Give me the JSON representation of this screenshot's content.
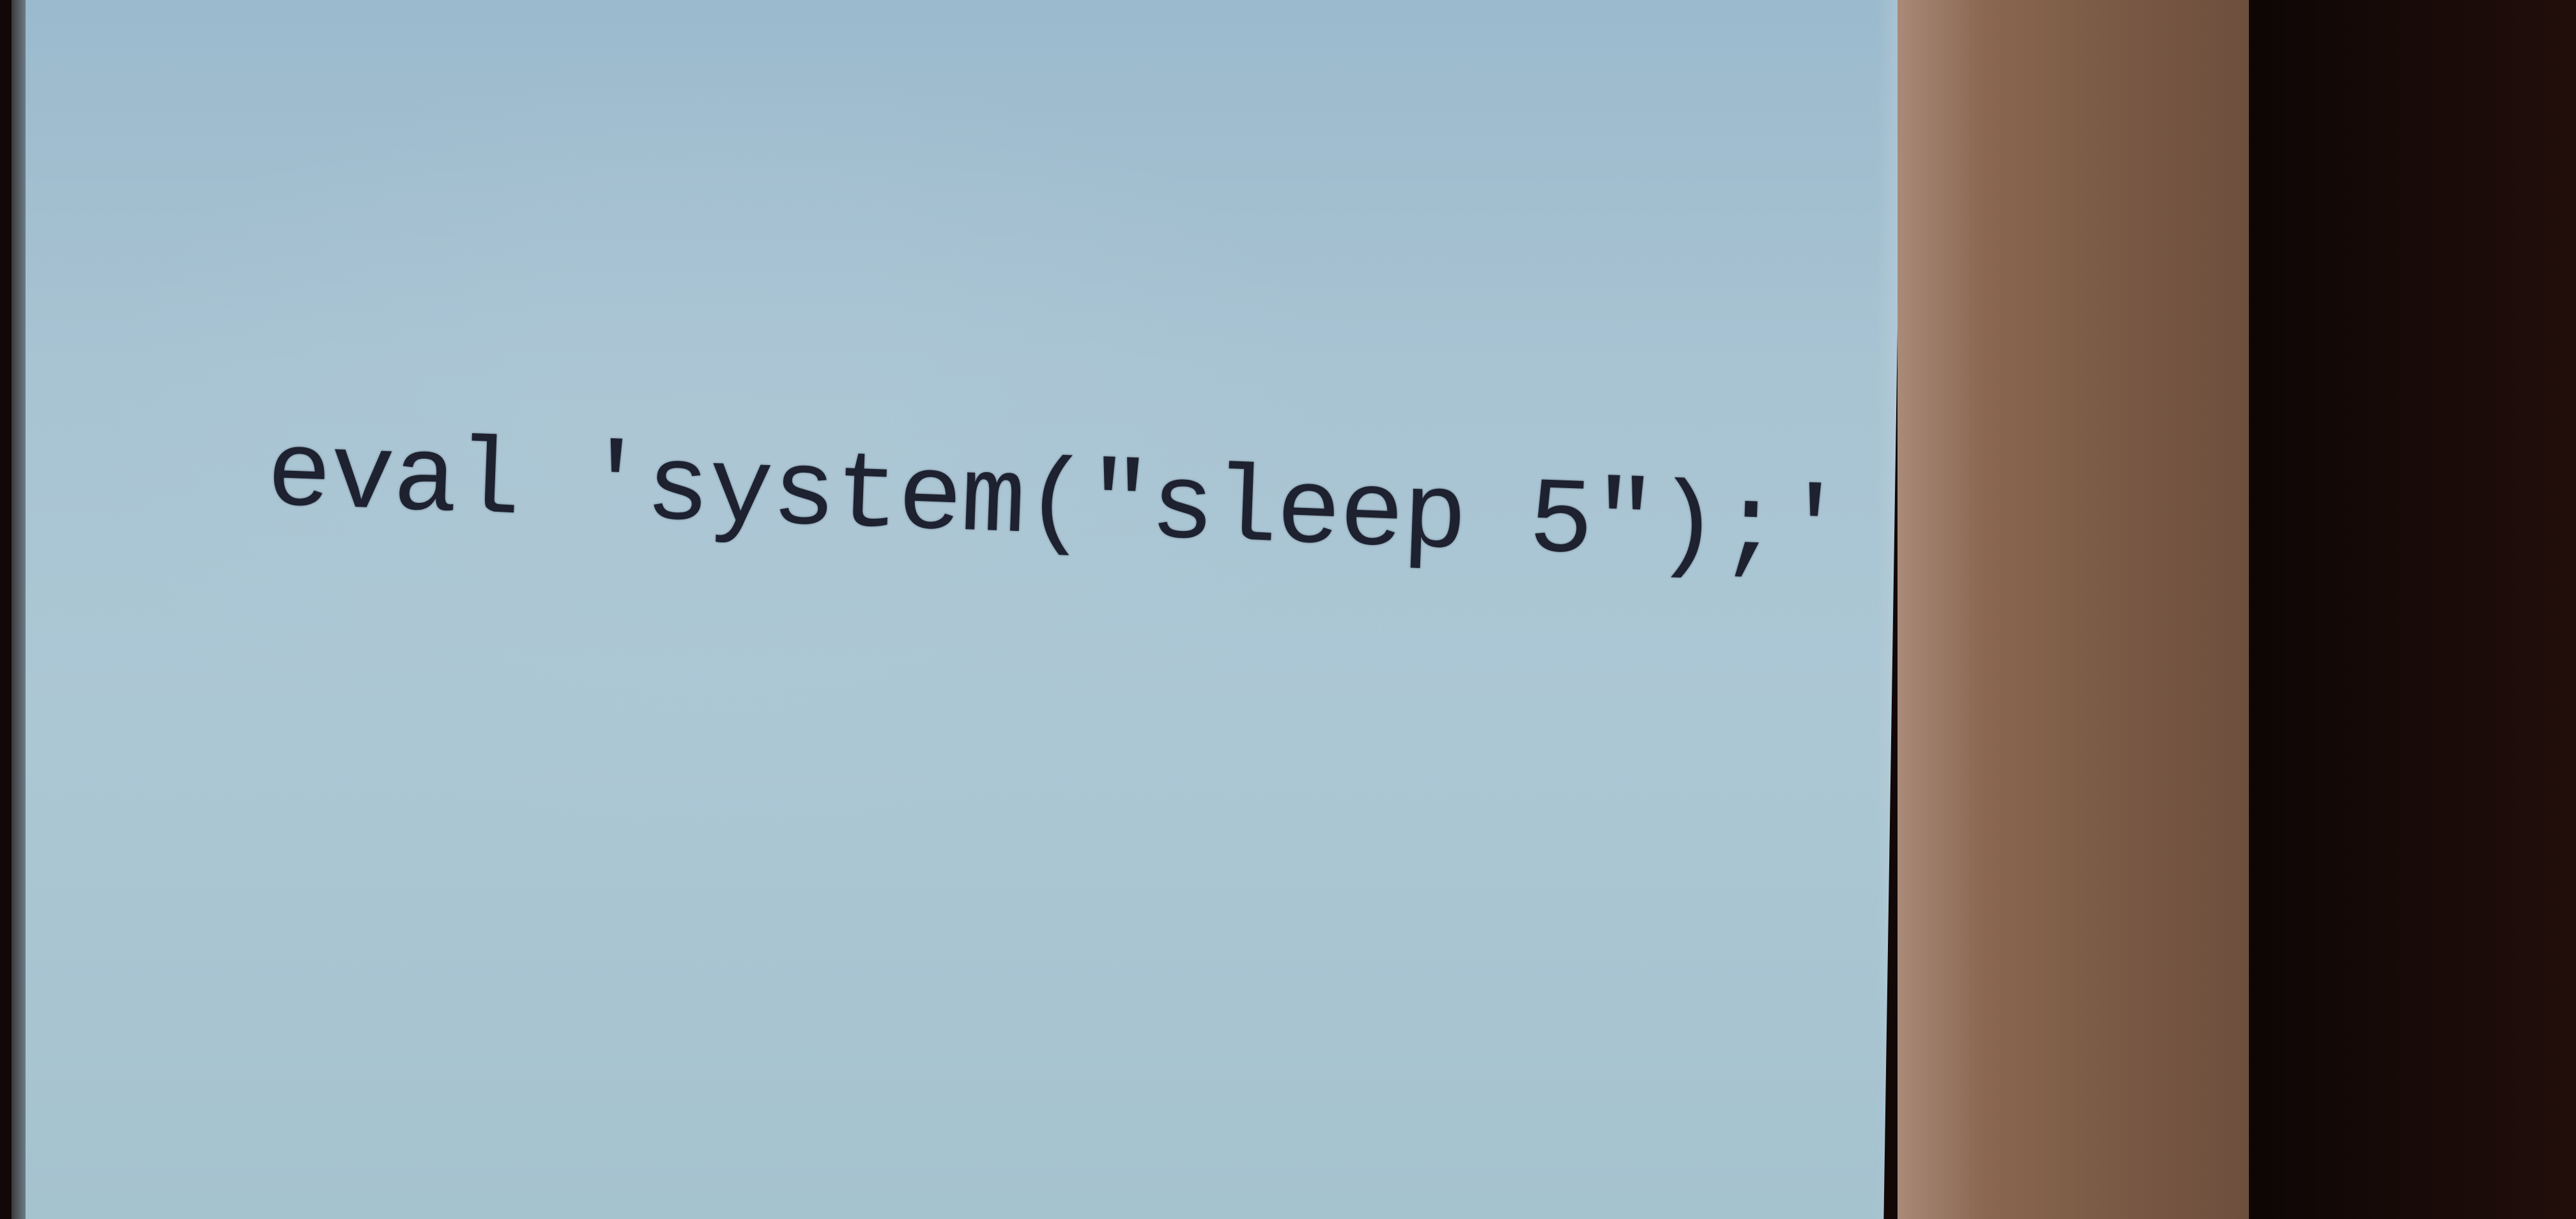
{
  "slide": {
    "code": "eval 'system(\"sleep 5\");'"
  },
  "colors": {
    "screen": "#a8c3d2",
    "text": "#1e2230",
    "wall": "#7a5a45",
    "dark": "#120808"
  }
}
